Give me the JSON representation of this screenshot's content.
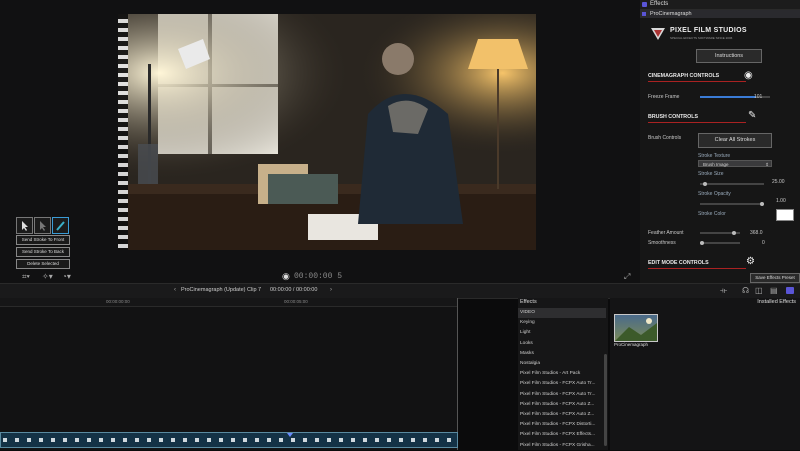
{
  "viewer": {
    "brush_buttons": [
      "Send Stroke To Front",
      "Send Stroke To Back",
      "Delete Selected"
    ],
    "timecode": "00:00:00 5"
  },
  "inspector": {
    "title": "Effects",
    "subtitle": "ProCinemagraph",
    "brand": {
      "name": "PIXEL FILM STUDIOS",
      "tagline": "SPECIAL EFFECTS SOFTWARE SINCE 2006"
    },
    "instructions_label": "Instructions",
    "cinemagraph_controls": "CINEMAGRAPH CONTROLS",
    "freeze_frame": {
      "label": "Freeze Frame",
      "value": "101",
      "level": 0.8
    },
    "brush_controls": "BRUSH CONTROLS",
    "brush_controls_label": "Brush Controls",
    "clear_all_label": "Clear All Strokes",
    "stroke_texture": {
      "label": "Stroke Texture",
      "value": "Brush Image"
    },
    "stroke_size": {
      "label": "Stroke Size",
      "value": "25.00",
      "level": 0.05
    },
    "stroke_opacity": {
      "label": "Stroke Opacity",
      "value": "1.00",
      "level": 1.0
    },
    "stroke_color_label": "Stroke Color",
    "feather_amount": {
      "label": "Feather Amount",
      "value": "368.0",
      "level": 0.9
    },
    "smoothness": {
      "label": "Smoothness",
      "value": "0",
      "level": 0.0
    },
    "edit_mode_controls": "EDIT MODE CONTROLS",
    "save_preset_label": "Save Effects Preset"
  },
  "midbar": {
    "clip_label": "ProCinemagraph (Update) Clip 7",
    "clip_time": "00:00:00 / 00:00:00"
  },
  "timeline": {
    "ruler_ticks": [
      "00:00:00:00",
      "00:00:05:00"
    ]
  },
  "effects_browser": {
    "header": "Effects",
    "installed_header": "Installed Effects",
    "categories": [
      "VIDEO",
      "Keying",
      "Light",
      "Looks",
      "Masks",
      "Nostalgia",
      "Pixel Film Studios - Art Pack",
      "Pixel Film Studios - FCPX Auto Tr...",
      "Pixel Film Studios - FCPX Auto Tr...",
      "Pixel Film Studios - FCPX Auto Z...",
      "Pixel Film Studios - FCPX Auto Z...",
      "Pixel Film Studios - FCPX Distorti...",
      "Pixel Film Studios - FCPX Effects...",
      "Pixel Film Studios - FCPX Grisha..."
    ],
    "selected_index": 0,
    "effect_tile_label": "ProCinemagraph"
  },
  "colors": {
    "accent": "#3a7bd5",
    "section_rule": "#aa2222",
    "highlight": "#5a55d6"
  }
}
